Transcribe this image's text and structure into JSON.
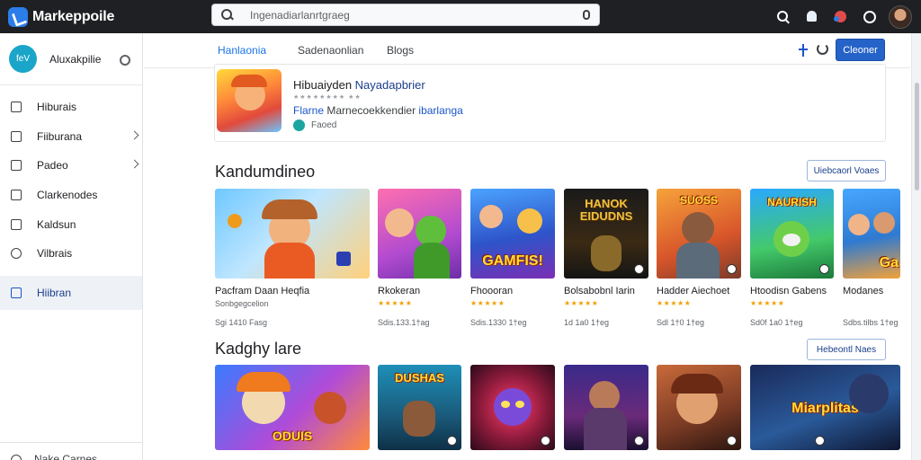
{
  "app": {
    "brand": "Markeppoile"
  },
  "search": {
    "value": "Ingenadiarlanrtgraeg"
  },
  "sidebar": {
    "account_name": "Aluxakpilie",
    "account_initials": "feV",
    "items": [
      {
        "label": "Hiburais",
        "icon": "grid-icon",
        "chevron": false,
        "active": false
      },
      {
        "label": "Fiiburana",
        "icon": "home-icon",
        "chevron": true,
        "active": false
      },
      {
        "label": "Padeo",
        "icon": "folder-icon",
        "chevron": true,
        "active": false
      },
      {
        "label": "Clarkenodes",
        "icon": "screen-icon",
        "chevron": false,
        "active": false
      },
      {
        "label": "Kaldsun",
        "icon": "bag-icon",
        "chevron": false,
        "active": false
      },
      {
        "label": "Vilbrais",
        "icon": "clock-icon",
        "chevron": false,
        "active": false
      },
      {
        "label": "Hiibran",
        "icon": "list-icon",
        "chevron": false,
        "active": true
      }
    ],
    "bottom_label": "Nake Carnes"
  },
  "subbar": {
    "tabs": [
      "Hanlaonia",
      "Sadenaonlian",
      "Blogs"
    ],
    "active_tab": 0,
    "button_label": "Cleoner"
  },
  "featured": {
    "title_main": "Hibuaiyden ",
    "title_highlight": "Nayadapbrier",
    "stars": "★★★★★★★★ ★★",
    "subtitle_blue": "Flarne ",
    "subtitle_gray": "Marnecoekkendier ",
    "subtitle_blue2": "ibarlanga",
    "badge": "Faoed"
  },
  "sections": [
    {
      "title": "Kandumdineo",
      "button": "Uiebcaorl Voaes",
      "apps": [
        {
          "name": "Pacfram Daan Heqfia",
          "developer": "Sonbgegcelion",
          "stars": "",
          "meta": "Sgi 1410 Fasg"
        },
        {
          "name": "Rkokeran",
          "developer": "",
          "stars": "★★★★★",
          "meta": "Sdis.133.1†ag"
        },
        {
          "name": "Fhoooran",
          "developer": "",
          "stars": "★★★★★",
          "meta": "Sdis.1330 1†eg"
        },
        {
          "name": "Bolsabobnl Iarin",
          "developer": "",
          "stars": "★★★★★",
          "meta": "1d 1a0 1†eg"
        },
        {
          "name": "Hadder Aiechoet",
          "developer": "",
          "stars": "★★★★★",
          "meta": "Sdl 1†0 1†eg"
        },
        {
          "name": "Htoodisn Gabens",
          "developer": "",
          "stars": "★★★★★",
          "meta": "Sd0f 1a0 1†eg"
        },
        {
          "name": "Modanes",
          "developer": "",
          "stars": "",
          "meta": "Sdbs.tilbs 1†eg"
        }
      ]
    },
    {
      "title": "Kadghy lare",
      "button": "Hebeontl Naes",
      "apps": [
        {
          "name": "",
          "developer": "",
          "stars": "",
          "meta": ""
        },
        {
          "name": "",
          "developer": "",
          "stars": "",
          "meta": ""
        },
        {
          "name": "",
          "developer": "",
          "stars": "",
          "meta": ""
        },
        {
          "name": "",
          "developer": "",
          "stars": "",
          "meta": ""
        },
        {
          "name": "",
          "developer": "",
          "stars": "",
          "meta": ""
        },
        {
          "name": "",
          "developer": "",
          "stars": "",
          "meta": ""
        }
      ]
    }
  ],
  "tile_words": {
    "row1_tile3": "GAMFIS!",
    "row1_tile4": "HANOK EIDUDNS",
    "row1_tile5": "SUOSS",
    "row1_tile6": "NAURISH",
    "row1_tile7": "Ga",
    "row2_tile1": "ODUIS",
    "row2_tile2": "DUSHAS",
    "row2_tile6": "Miarplitas"
  },
  "colors": {
    "topbar": "#1f2023",
    "accent": "#1a73e8",
    "primary_button": "#2563c9",
    "active_nav_bg": "#eef1f6",
    "star": "#f2a007"
  }
}
